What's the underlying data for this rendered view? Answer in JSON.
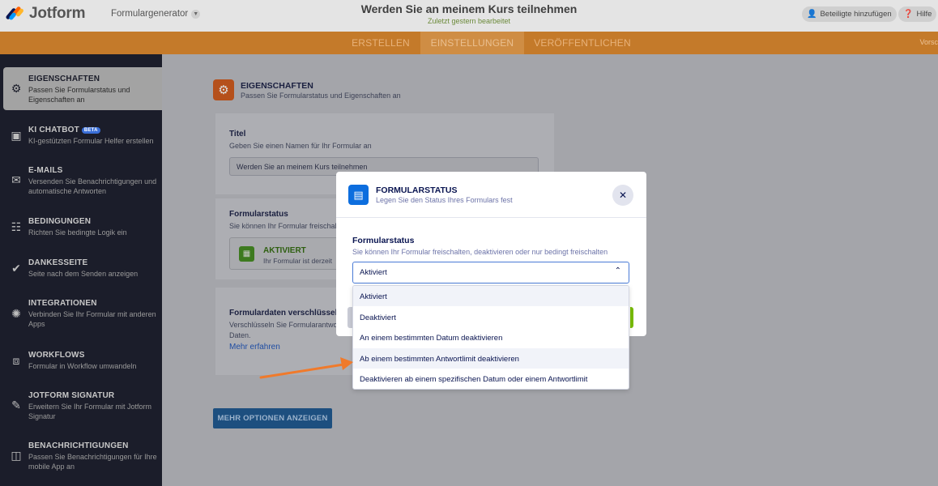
{
  "header": {
    "logo_text": "Jotform",
    "builder_label": "Formulargenerator",
    "form_title": "Werden Sie an meinem Kurs teilnehmen",
    "form_subtitle": "Zuletzt gestern bearbeitet",
    "invite_label": "Beteiligte hinzufügen",
    "help_label": "Hilfe",
    "logo_colors": [
      "#0a1551",
      "#ff6100",
      "#ffb629",
      "#0099ff"
    ]
  },
  "nav": {
    "tabs": [
      {
        "label": "ERSTELLEN"
      },
      {
        "label": "EINSTELLUNGEN",
        "active": true
      },
      {
        "label": "VERÖFFENTLICHEN"
      }
    ],
    "right_truncated": "Vorsc"
  },
  "sidebar": {
    "items": [
      {
        "title": "EIGENSCHAFTEN",
        "desc": "Passen Sie Formularstatus und Eigenschaften an",
        "icon": "gear-icon",
        "active": true
      },
      {
        "title": "KI CHATBOT",
        "badge": "BETA",
        "desc": "KI-gestützten Formular Helfer erstellen",
        "icon": "robot-icon"
      },
      {
        "title": "E-MAILS",
        "desc": "Versenden Sie Benachrichtigungen und automatische Antworten",
        "icon": "envelope-icon"
      },
      {
        "title": "BEDINGUNGEN",
        "desc": "Richten Sie bedingte Logik ein",
        "icon": "conditions-icon"
      },
      {
        "title": "DANKESSEITE",
        "desc": "Seite nach dem Senden anzeigen",
        "icon": "check-circle-icon"
      },
      {
        "title": "INTEGRATIONEN",
        "desc": "Verbinden Sie Ihr Formular mit anderen Apps",
        "icon": "puzzle-icon"
      },
      {
        "title": "WORKFLOWS",
        "desc": "Formular in Workflow umwandeln",
        "icon": "workflow-icon"
      },
      {
        "title": "JOTFORM SIGNATUR",
        "desc": "Erweitern Sie Ihr Formular mit Jotform Signatur",
        "icon": "pen-icon"
      },
      {
        "title": "BENACHRICHTIGUNGEN",
        "desc": "Passen Sie Benachrichtigungen für Ihre mobile App an",
        "icon": "phone-icon"
      }
    ]
  },
  "main": {
    "section_title": "EIGENSCHAFTEN",
    "section_desc": "Passen Sie Formularstatus und Eigenschaften an",
    "title_label": "Titel",
    "title_desc": "Geben Sie einen Namen für Ihr Formular an",
    "title_value": "Werden Sie an meinem Kurs teilnehmen",
    "status_label": "Formularstatus",
    "status_desc": "Sie können Ihr Formular freischalte",
    "status_word": "AKTIVIERT",
    "status_sub": "Ihr Formular ist derzeit",
    "encrypt_label": "Formulardaten verschlüssel",
    "encrypt_desc_line1": "Verschlüsseln Sie Formularantwo",
    "encrypt_desc_line2": "Daten.",
    "encrypt_link": "Mehr erfahren",
    "more_button": "MEHR OPTIONEN ANZEIGEN"
  },
  "modal": {
    "title": "FORMULARSTATUS",
    "subtitle": "Legen Sie den Status Ihres Formulars fest",
    "field_label": "Formularstatus",
    "field_desc": "Sie können Ihr Formular freischalten, deaktivieren oder nur bedingt freischalten",
    "selected_value": "Aktiviert",
    "options": [
      "Aktiviert",
      "Deaktiviert",
      "An einem bestimmten Datum deaktivieren",
      "Ab einem bestimmten Antwortlimit deaktivieren",
      "Deaktivieren ab einem spezifischen Datum oder einem Antwortlimit"
    ]
  },
  "colors": {
    "accent_orange": "#ff6100",
    "annotation_arrow": "#f07a2b",
    "modal_icon_blue": "#0d6ede",
    "active_green": "#78bb07"
  }
}
